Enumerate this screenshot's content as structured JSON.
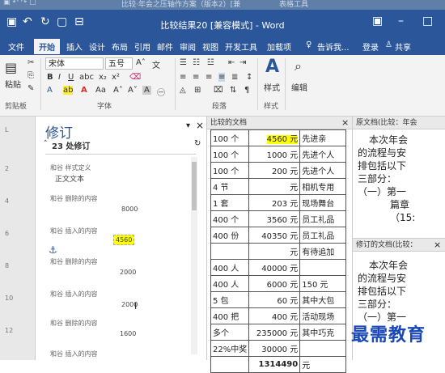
{
  "ghost_titlebar": {
    "text_1": "比较·年会之压轴作方案（版本2）[兼",
    "text_2": "表格工具"
  },
  "titlebar": {
    "title": "比较结果20 [兼容模式] - Word",
    "share": "登录"
  },
  "tabs": [
    "文件",
    "开始",
    "插入",
    "设计",
    "布局",
    "引用",
    "邮件",
    "审阅",
    "视图",
    "开发工具",
    "加载项"
  ],
  "tell_me": "告诉我...",
  "login": "登录",
  "share_label": "共享",
  "ribbon": {
    "paste": "粘贴",
    "font_name": "宋体",
    "font_size": "五号",
    "style_label": "样式",
    "edit_label": "编辑",
    "groups": {
      "clipboard": "剪贴板",
      "font": "字体",
      "paragraph": "段落",
      "style": "样式"
    }
  },
  "revision_pane": {
    "title": "修订",
    "count": "23 处修订",
    "items": [
      {
        "author": "和谷 样式定义",
        "text": "正文文本"
      },
      {
        "author": "和谷 删除的内容",
        "text": "8000"
      },
      {
        "author": "和谷 插入的内容",
        "text": "4560"
      },
      {
        "author": "和谷 删除的内容",
        "text": "2000"
      },
      {
        "author": "和谷 插入的内容",
        "text": "2000"
      },
      {
        "author": "和谷 删除的内容",
        "text": "1600"
      },
      {
        "author": "和谷 插入的内容",
        "text": ""
      }
    ]
  },
  "compared_doc": {
    "header": "比较的文档",
    "rows": [
      [
        "100 个",
        "4560 元",
        "先进亲"
      ],
      [
        "100 个",
        "1000 元",
        "先进个人"
      ],
      [
        "100 个",
        "200 元",
        "先进个人"
      ],
      [
        "4 节",
        "元",
        "相机专用"
      ],
      [
        "1 套",
        "203 元",
        "现场舞台"
      ],
      [
        "400 个",
        "3560 元",
        "员工礼品"
      ],
      [
        "400 份",
        "40350 元",
        "员工礼品"
      ],
      [
        "",
        "元",
        "有待追加"
      ],
      [
        "400 人",
        "40000 元",
        ""
      ],
      [
        "400 人",
        "6000 元",
        "150 元"
      ],
      [
        "5 包",
        "60 元",
        "其中大包"
      ],
      [
        "400 把",
        "400 元",
        "活动现场"
      ],
      [
        "多个",
        "235000 元",
        "其中巧克"
      ],
      [
        "22%中奖",
        "30000 元",
        ""
      ],
      [
        "",
        "1314490",
        "元"
      ]
    ]
  },
  "original_doc": {
    "header": "原文档(比较：年会",
    "lines": [
      "本次年会",
      "的流程与安",
      "排包括以下",
      "三部分：",
      "（一）第一",
      "篇章",
      "（15:"
    ]
  },
  "revised_doc": {
    "header": "修订的文档(比较：",
    "lines": [
      "本次年会",
      "的流程与安",
      "排包括以下",
      "三部分：",
      "（一）第一"
    ]
  },
  "watermark": "最需教育"
}
